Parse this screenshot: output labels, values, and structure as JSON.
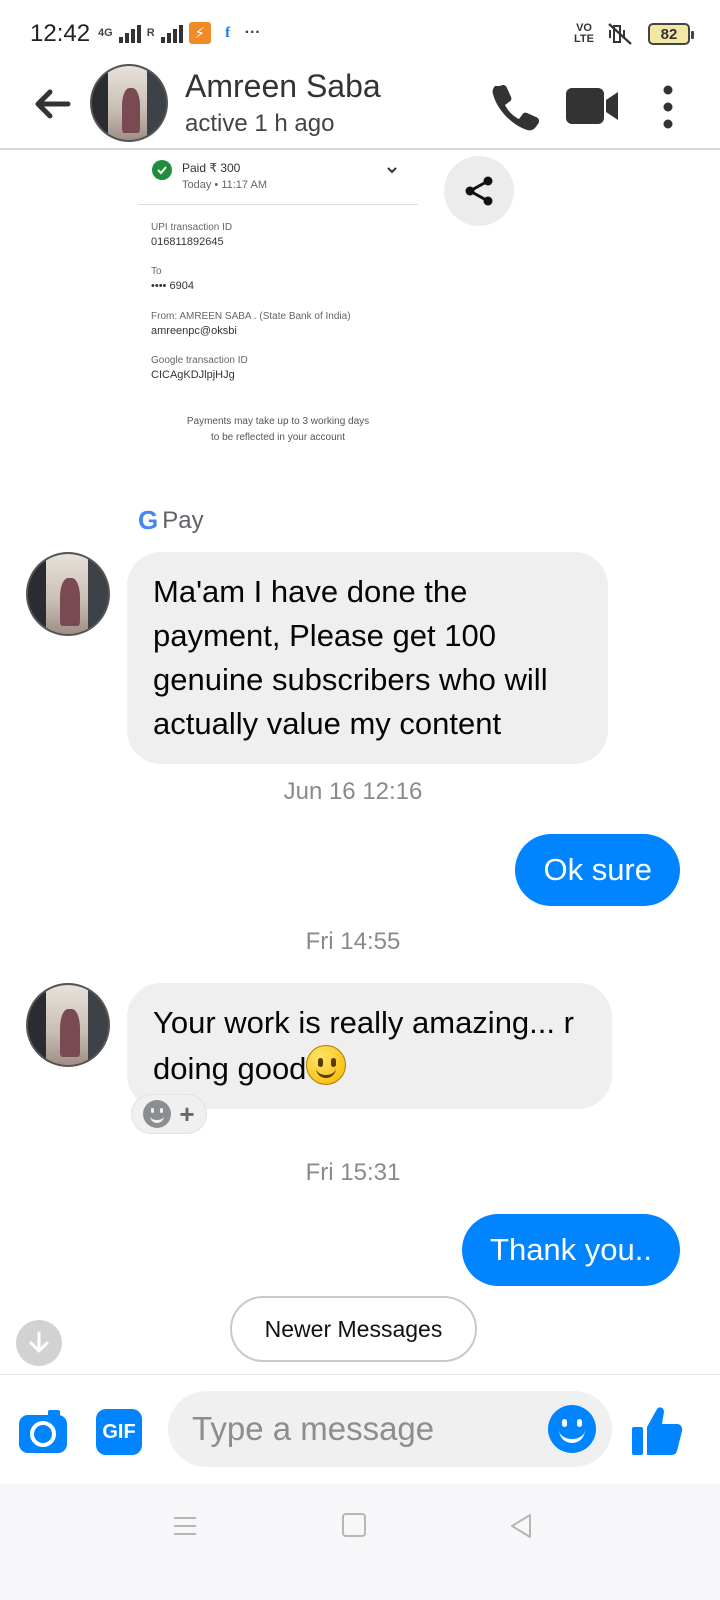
{
  "status_bar": {
    "time": "12:42",
    "network_label": "4G",
    "roaming_label": "R",
    "more_glyph": "···",
    "volte_line1": "VO",
    "volte_line2": "LTE",
    "battery": "82",
    "icons": [
      "orange-app-icon",
      "facebook-icon",
      "mute-vibrate-icon"
    ]
  },
  "header": {
    "contact_name": "Amreen Saba",
    "contact_status": "active 1 h ago",
    "icons": [
      "back-arrow-icon",
      "phone-icon",
      "video-camera-icon",
      "more-vertical-icon"
    ]
  },
  "receipt": {
    "paid": "Paid ₹ 300",
    "paid_time": "Today • 11:17 AM",
    "upi_label": "UPI transaction ID",
    "upi_value": "016811892645",
    "to_label": "To",
    "to_value": "•••• 6904",
    "from_label": "From: AMREEN SABA  . (State Bank of India)",
    "from_value": "amreenpc@oksbi",
    "google_label": "Google transaction ID",
    "google_value": "CICAgKDJlpjHJg",
    "note_line1": "Payments may take up to 3 working days",
    "note_line2": "to be reflected in your account",
    "brand_g": "G",
    "brand_text": "Pay"
  },
  "messages": [
    {
      "direction": "incoming",
      "text": "Ma'am I have done the payment, Please get 100 genuine subscribers who will actually value my content"
    },
    {
      "timestamp": "Jun 16 12:16"
    },
    {
      "direction": "outgoing",
      "text": "Ok sure"
    },
    {
      "timestamp": "Fri 14:55"
    },
    {
      "direction": "incoming",
      "text": "Your work is really amazing... r doing good"
    },
    {
      "timestamp": "Fri 15:31"
    },
    {
      "direction": "outgoing",
      "text": "Thank you.."
    }
  ],
  "react_plus": "+",
  "newer_messages_label": "Newer Messages",
  "composer": {
    "gif_label": "GIF",
    "placeholder": "Type a message",
    "value": ""
  },
  "colors": {
    "messenger_blue": "#0084ff",
    "incoming_bubble": "#efefef",
    "timestamp_gray": "#8a8a8a",
    "gpay_green": "#1e8e3e"
  }
}
